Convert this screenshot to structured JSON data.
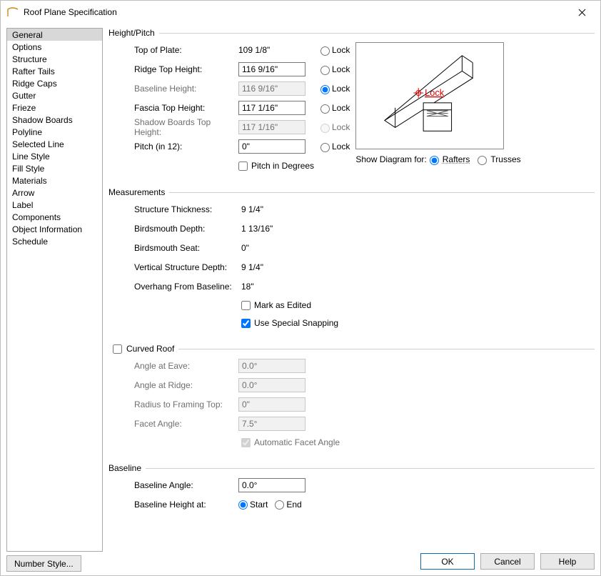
{
  "window": {
    "title": "Roof Plane Specification"
  },
  "sidebar": {
    "items": [
      "General",
      "Options",
      "Structure",
      "Rafter Tails",
      "Ridge Caps",
      "Gutter",
      "Frieze",
      "Shadow Boards",
      "Polyline",
      "Selected Line",
      "Line Style",
      "Fill Style",
      "Materials",
      "Arrow",
      "Label",
      "Components",
      "Object Information",
      "Schedule"
    ],
    "selected_index": 0
  },
  "heightPitch": {
    "legend": "Height/Pitch",
    "topOfPlate": {
      "label": "Top of Plate:",
      "value": "109 1/8\"",
      "lockLabel": "Lock"
    },
    "ridgeTopHeight": {
      "label": "Ridge Top Height:",
      "value": "116 9/16\"",
      "lockLabel": "Lock"
    },
    "baselineHeight": {
      "label": "Baseline Height:",
      "value": "116 9/16\"",
      "lockLabel": "Lock",
      "lockSelected": true
    },
    "fasciaTopHeight": {
      "label": "Fascia Top Height:",
      "value": "117 1/16\"",
      "lockLabel": "Lock"
    },
    "shadowBoardsTopHeight": {
      "label": "Shadow Boards Top Height:",
      "value": "117 1/16\"",
      "lockLabel": "Lock"
    },
    "pitch": {
      "label": "Pitch (in 12):",
      "value": "0\"",
      "lockLabel": "Lock"
    },
    "pitchInDegrees": {
      "label": "Pitch in Degrees",
      "checked": false
    },
    "diagramLabel": "Show Diagram for:",
    "diagramRafters": "Rafters",
    "diagramTrusses": "Trusses",
    "diagramLockText": "Lock"
  },
  "measurements": {
    "legend": "Measurements",
    "structureThickness": {
      "label": "Structure Thickness:",
      "value": "9 1/4\""
    },
    "birdsmouthDepth": {
      "label": "Birdsmouth Depth:",
      "value": "1 13/16\""
    },
    "birdsmouthSeat": {
      "label": "Birdsmouth Seat:",
      "value": "0\""
    },
    "verticalStructureDepth": {
      "label": "Vertical Structure Depth:",
      "value": "9 1/4\""
    },
    "overhangFromBaseline": {
      "label": "Overhang From Baseline:",
      "value": "18\""
    },
    "markAsEdited": {
      "label": "Mark as Edited",
      "checked": false
    },
    "useSpecialSnapping": {
      "label": "Use Special Snapping",
      "checked": true
    }
  },
  "curved": {
    "legend": "Curved Roof",
    "enabled": false,
    "angleAtEave": {
      "label": "Angle at Eave:",
      "value": "0.0°"
    },
    "angleAtRidge": {
      "label": "Angle at Ridge:",
      "value": "0.0°"
    },
    "radiusToFramingTop": {
      "label": "Radius to Framing Top:",
      "value": "0\""
    },
    "facetAngle": {
      "label": "Facet Angle:",
      "value": "7.5°"
    },
    "automaticFacetAngle": {
      "label": "Automatic Facet Angle",
      "checked": true
    }
  },
  "baseline": {
    "legend": "Baseline",
    "baselineAngle": {
      "label": "Baseline Angle:",
      "value": "0.0°"
    },
    "baselineHeightAt": {
      "label": "Baseline Height at:",
      "start": "Start",
      "end": "End",
      "selected": "start"
    }
  },
  "footer": {
    "numberStyle": "Number Style...",
    "ok": "OK",
    "cancel": "Cancel",
    "help": "Help"
  }
}
